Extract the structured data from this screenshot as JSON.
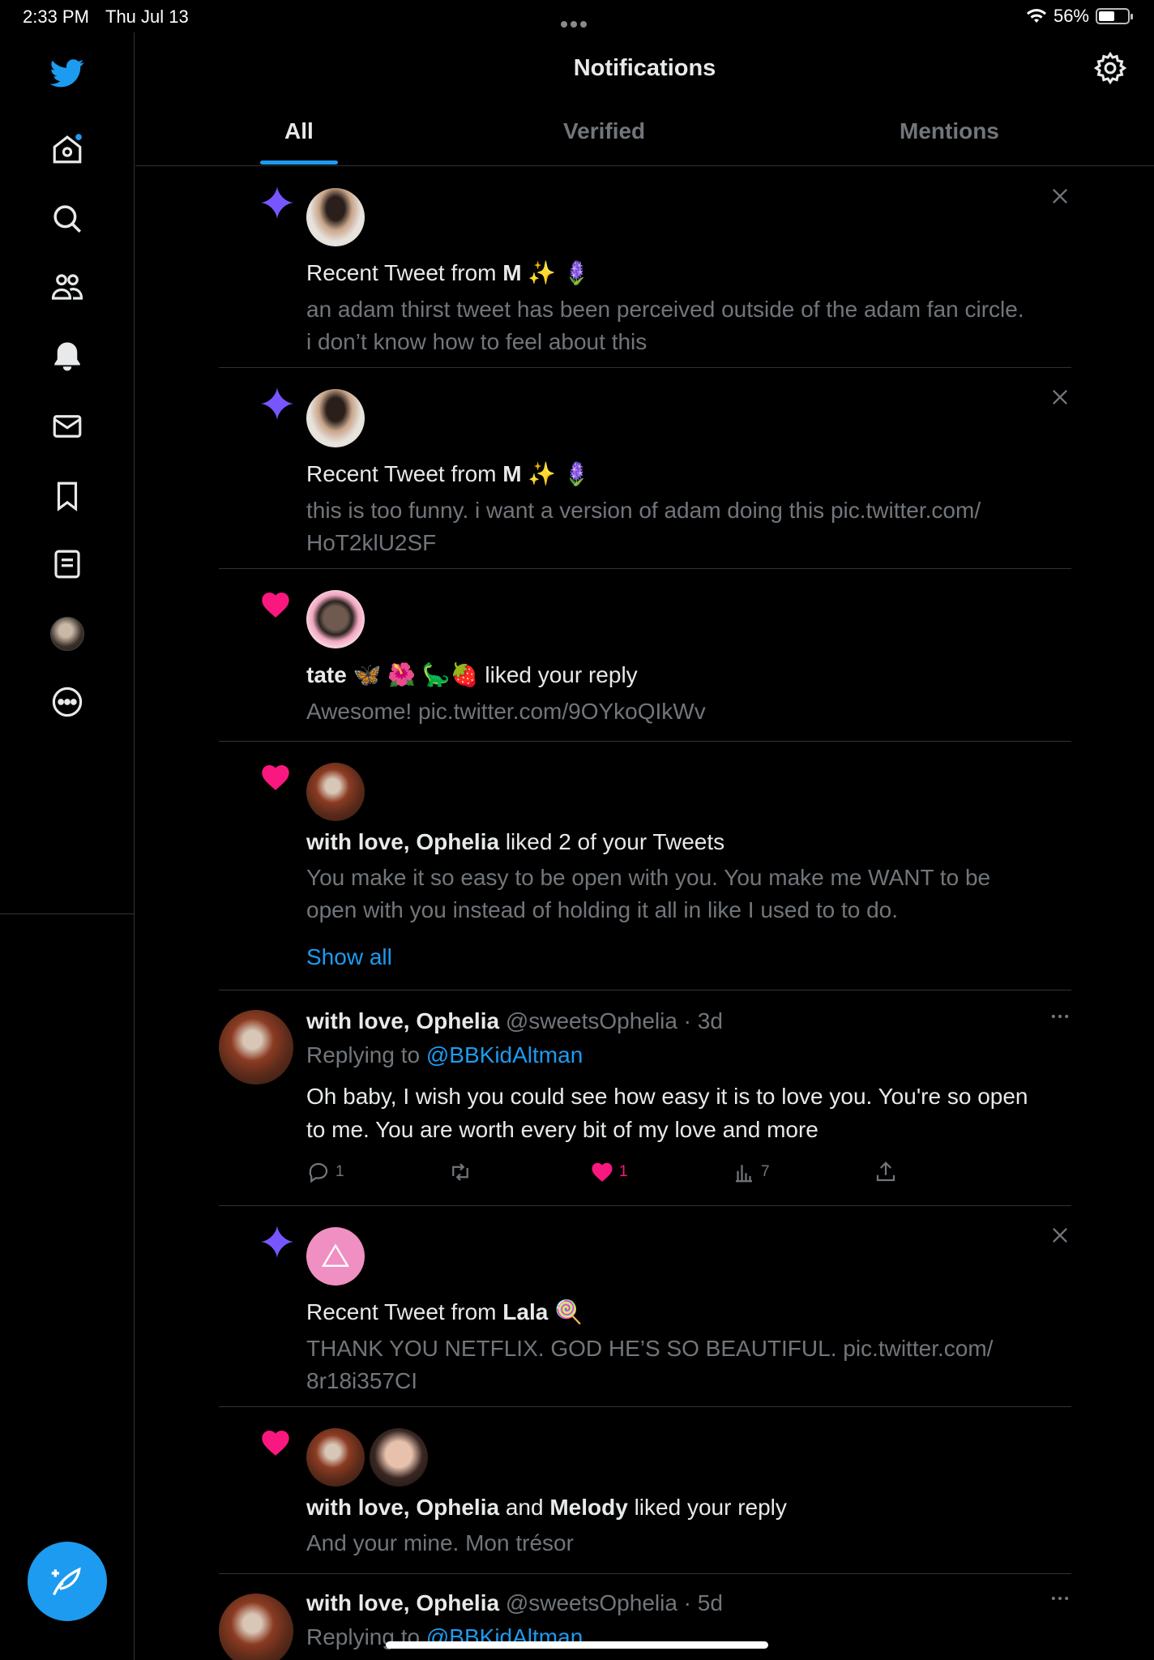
{
  "status_bar": {
    "time": "2:33 PM",
    "date": "Thu Jul 13",
    "battery": "56%",
    "battery_level": 0.56
  },
  "header": {
    "title": "Notifications",
    "tabs": [
      "All",
      "Verified",
      "Mentions"
    ],
    "active_tab": "All"
  },
  "colors": {
    "accent": "#1d9bf0",
    "like": "#f91880",
    "sparkle": "#7856ff",
    "background": "#000000"
  },
  "notifications": [
    {
      "type": "recent_tweet",
      "icon": "sparkle-icon",
      "prefix": "Recent Tweet from ",
      "name": "M",
      "emoji": "✨ 🪻",
      "line1": "an adam thirst tweet has been perceived outside of the adam fan circle.",
      "line2": "i don’t know how to feel about this"
    },
    {
      "type": "recent_tweet",
      "icon": "sparkle-icon",
      "prefix": "Recent Tweet from ",
      "name": "M",
      "emoji": "✨ 🪻",
      "line1": "this is too funny. i want a version of adam doing this pic.twitter.com/",
      "line2": "HoT2klU2SF"
    },
    {
      "type": "like",
      "icon": "heart-icon",
      "name": "tate",
      "emoji": "🦋 🌺 🦕🍓",
      "action": " liked your reply",
      "line1": "Awesome! pic.twitter.com/9OYkoQIkWv"
    },
    {
      "type": "like",
      "icon": "heart-icon",
      "name": "with love, Ophelia",
      "action": " liked 2 of your Tweets",
      "line1": "You make it so easy to be open with you.  You make me WANT to be",
      "line2": "open with you instead of holding it all in like I used to to do.",
      "show_all": "Show all"
    },
    {
      "type": "recent_tweet",
      "icon": "sparkle-icon",
      "prefix": "Recent Tweet from ",
      "name": "Lala",
      "emoji": "🍭",
      "line1": "THANK YOU NETFLIX. GOD HE’S SO BEAUTIFUL. pic.twitter.com/",
      "line2": "8r18i357CI"
    },
    {
      "type": "like",
      "icon": "heart-icon",
      "name": "with love, Ophelia",
      "joiner": " and ",
      "name2": "Melody",
      "action": " liked your reply",
      "line1": "And your mine.  Mon trésor"
    }
  ],
  "tweets": [
    {
      "name": "with love, Ophelia",
      "handle": "@sweetsOphelia",
      "sep": " · ",
      "time": "3d",
      "replying_prefix": "Replying to ",
      "replying_to": "@BBKidAltman",
      "line1": "Oh baby, I wish you could see how easy it is to love you. You're so open",
      "line2": "to me. You are worth every bit of my love and more",
      "replies": "1",
      "likes": "1",
      "views": "7"
    },
    {
      "name": "with love, Ophelia",
      "handle": "@sweetsOphelia",
      "sep": " · ",
      "time": "5d",
      "replying_prefix": "Replying to ",
      "replying_to": "@BBKidAltman"
    }
  ]
}
